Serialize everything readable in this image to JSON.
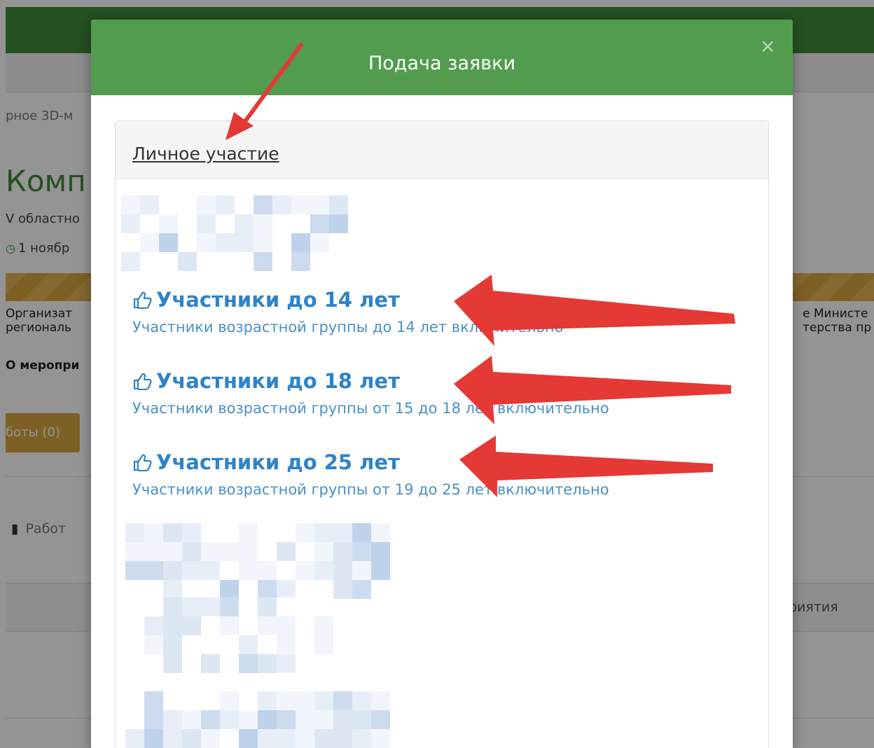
{
  "background": {
    "breadcrumb": "рное 3D-м",
    "title": "Комп",
    "subtitle": "V областно",
    "date": "1 ноябр",
    "organizer_line1": "Организат",
    "organizer_line2": "региональ",
    "organizer_right_line1": "е Министе",
    "organizer_right_line2": "терства пр",
    "about": "О меропри",
    "dash": "-",
    "works_button": "боты (0)",
    "tab_works": "Работ",
    "column_head": "риятия"
  },
  "modal": {
    "title": "Подача заявки",
    "close_glyph": "×",
    "panel_heading": "Личное участие",
    "options": [
      {
        "title": "Участники до 14 лет",
        "description": "Участники возрастной группы до 14 лет включительно"
      },
      {
        "title": "Участники до 18 лет",
        "description": "Участники возрастной группы от 15 до 18 лет включительно"
      },
      {
        "title": "Участники до 25 лет",
        "description": "Участники возрастной группы от 19 до 25 лет включительно"
      }
    ]
  },
  "icons": {
    "option_icon": "thumbs-up-icon",
    "clock_icon": "clock-icon",
    "book_icon": "book-icon",
    "close_icon": "close-icon"
  },
  "colors": {
    "header_green": "#3f8b3b",
    "modal_header_green": "#529c4e",
    "link_blue": "#2f83c8",
    "accent_gold": "#d9a640",
    "arrow_red": "#e53935"
  }
}
